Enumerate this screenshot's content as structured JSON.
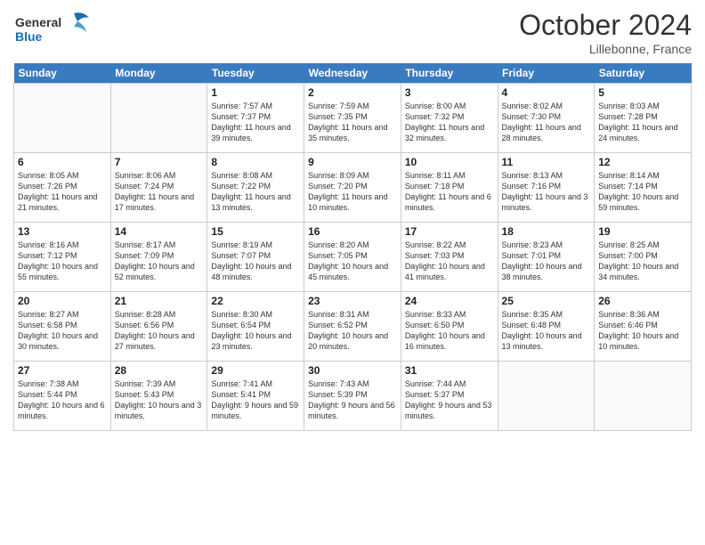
{
  "logo": {
    "line1": "General",
    "line2": "Blue"
  },
  "title": "October 2024",
  "location": "Lillebonne, France",
  "days_of_week": [
    "Sunday",
    "Monday",
    "Tuesday",
    "Wednesday",
    "Thursday",
    "Friday",
    "Saturday"
  ],
  "weeks": [
    [
      {
        "num": "",
        "info": ""
      },
      {
        "num": "",
        "info": ""
      },
      {
        "num": "1",
        "info": "Sunrise: 7:57 AM\nSunset: 7:37 PM\nDaylight: 11 hours\nand 39 minutes."
      },
      {
        "num": "2",
        "info": "Sunrise: 7:59 AM\nSunset: 7:35 PM\nDaylight: 11 hours\nand 35 minutes."
      },
      {
        "num": "3",
        "info": "Sunrise: 8:00 AM\nSunset: 7:32 PM\nDaylight: 11 hours\nand 32 minutes."
      },
      {
        "num": "4",
        "info": "Sunrise: 8:02 AM\nSunset: 7:30 PM\nDaylight: 11 hours\nand 28 minutes."
      },
      {
        "num": "5",
        "info": "Sunrise: 8:03 AM\nSunset: 7:28 PM\nDaylight: 11 hours\nand 24 minutes."
      }
    ],
    [
      {
        "num": "6",
        "info": "Sunrise: 8:05 AM\nSunset: 7:26 PM\nDaylight: 11 hours\nand 21 minutes."
      },
      {
        "num": "7",
        "info": "Sunrise: 8:06 AM\nSunset: 7:24 PM\nDaylight: 11 hours\nand 17 minutes."
      },
      {
        "num": "8",
        "info": "Sunrise: 8:08 AM\nSunset: 7:22 PM\nDaylight: 11 hours\nand 13 minutes."
      },
      {
        "num": "9",
        "info": "Sunrise: 8:09 AM\nSunset: 7:20 PM\nDaylight: 11 hours\nand 10 minutes."
      },
      {
        "num": "10",
        "info": "Sunrise: 8:11 AM\nSunset: 7:18 PM\nDaylight: 11 hours\nand 6 minutes."
      },
      {
        "num": "11",
        "info": "Sunrise: 8:13 AM\nSunset: 7:16 PM\nDaylight: 11 hours\nand 3 minutes."
      },
      {
        "num": "12",
        "info": "Sunrise: 8:14 AM\nSunset: 7:14 PM\nDaylight: 10 hours\nand 59 minutes."
      }
    ],
    [
      {
        "num": "13",
        "info": "Sunrise: 8:16 AM\nSunset: 7:12 PM\nDaylight: 10 hours\nand 55 minutes."
      },
      {
        "num": "14",
        "info": "Sunrise: 8:17 AM\nSunset: 7:09 PM\nDaylight: 10 hours\nand 52 minutes."
      },
      {
        "num": "15",
        "info": "Sunrise: 8:19 AM\nSunset: 7:07 PM\nDaylight: 10 hours\nand 48 minutes."
      },
      {
        "num": "16",
        "info": "Sunrise: 8:20 AM\nSunset: 7:05 PM\nDaylight: 10 hours\nand 45 minutes."
      },
      {
        "num": "17",
        "info": "Sunrise: 8:22 AM\nSunset: 7:03 PM\nDaylight: 10 hours\nand 41 minutes."
      },
      {
        "num": "18",
        "info": "Sunrise: 8:23 AM\nSunset: 7:01 PM\nDaylight: 10 hours\nand 38 minutes."
      },
      {
        "num": "19",
        "info": "Sunrise: 8:25 AM\nSunset: 7:00 PM\nDaylight: 10 hours\nand 34 minutes."
      }
    ],
    [
      {
        "num": "20",
        "info": "Sunrise: 8:27 AM\nSunset: 6:58 PM\nDaylight: 10 hours\nand 30 minutes."
      },
      {
        "num": "21",
        "info": "Sunrise: 8:28 AM\nSunset: 6:56 PM\nDaylight: 10 hours\nand 27 minutes."
      },
      {
        "num": "22",
        "info": "Sunrise: 8:30 AM\nSunset: 6:54 PM\nDaylight: 10 hours\nand 23 minutes."
      },
      {
        "num": "23",
        "info": "Sunrise: 8:31 AM\nSunset: 6:52 PM\nDaylight: 10 hours\nand 20 minutes."
      },
      {
        "num": "24",
        "info": "Sunrise: 8:33 AM\nSunset: 6:50 PM\nDaylight: 10 hours\nand 16 minutes."
      },
      {
        "num": "25",
        "info": "Sunrise: 8:35 AM\nSunset: 6:48 PM\nDaylight: 10 hours\nand 13 minutes."
      },
      {
        "num": "26",
        "info": "Sunrise: 8:36 AM\nSunset: 6:46 PM\nDaylight: 10 hours\nand 10 minutes."
      }
    ],
    [
      {
        "num": "27",
        "info": "Sunrise: 7:38 AM\nSunset: 5:44 PM\nDaylight: 10 hours\nand 6 minutes."
      },
      {
        "num": "28",
        "info": "Sunrise: 7:39 AM\nSunset: 5:43 PM\nDaylight: 10 hours\nand 3 minutes."
      },
      {
        "num": "29",
        "info": "Sunrise: 7:41 AM\nSunset: 5:41 PM\nDaylight: 9 hours\nand 59 minutes."
      },
      {
        "num": "30",
        "info": "Sunrise: 7:43 AM\nSunset: 5:39 PM\nDaylight: 9 hours\nand 56 minutes."
      },
      {
        "num": "31",
        "info": "Sunrise: 7:44 AM\nSunset: 5:37 PM\nDaylight: 9 hours\nand 53 minutes."
      },
      {
        "num": "",
        "info": ""
      },
      {
        "num": "",
        "info": ""
      }
    ]
  ]
}
